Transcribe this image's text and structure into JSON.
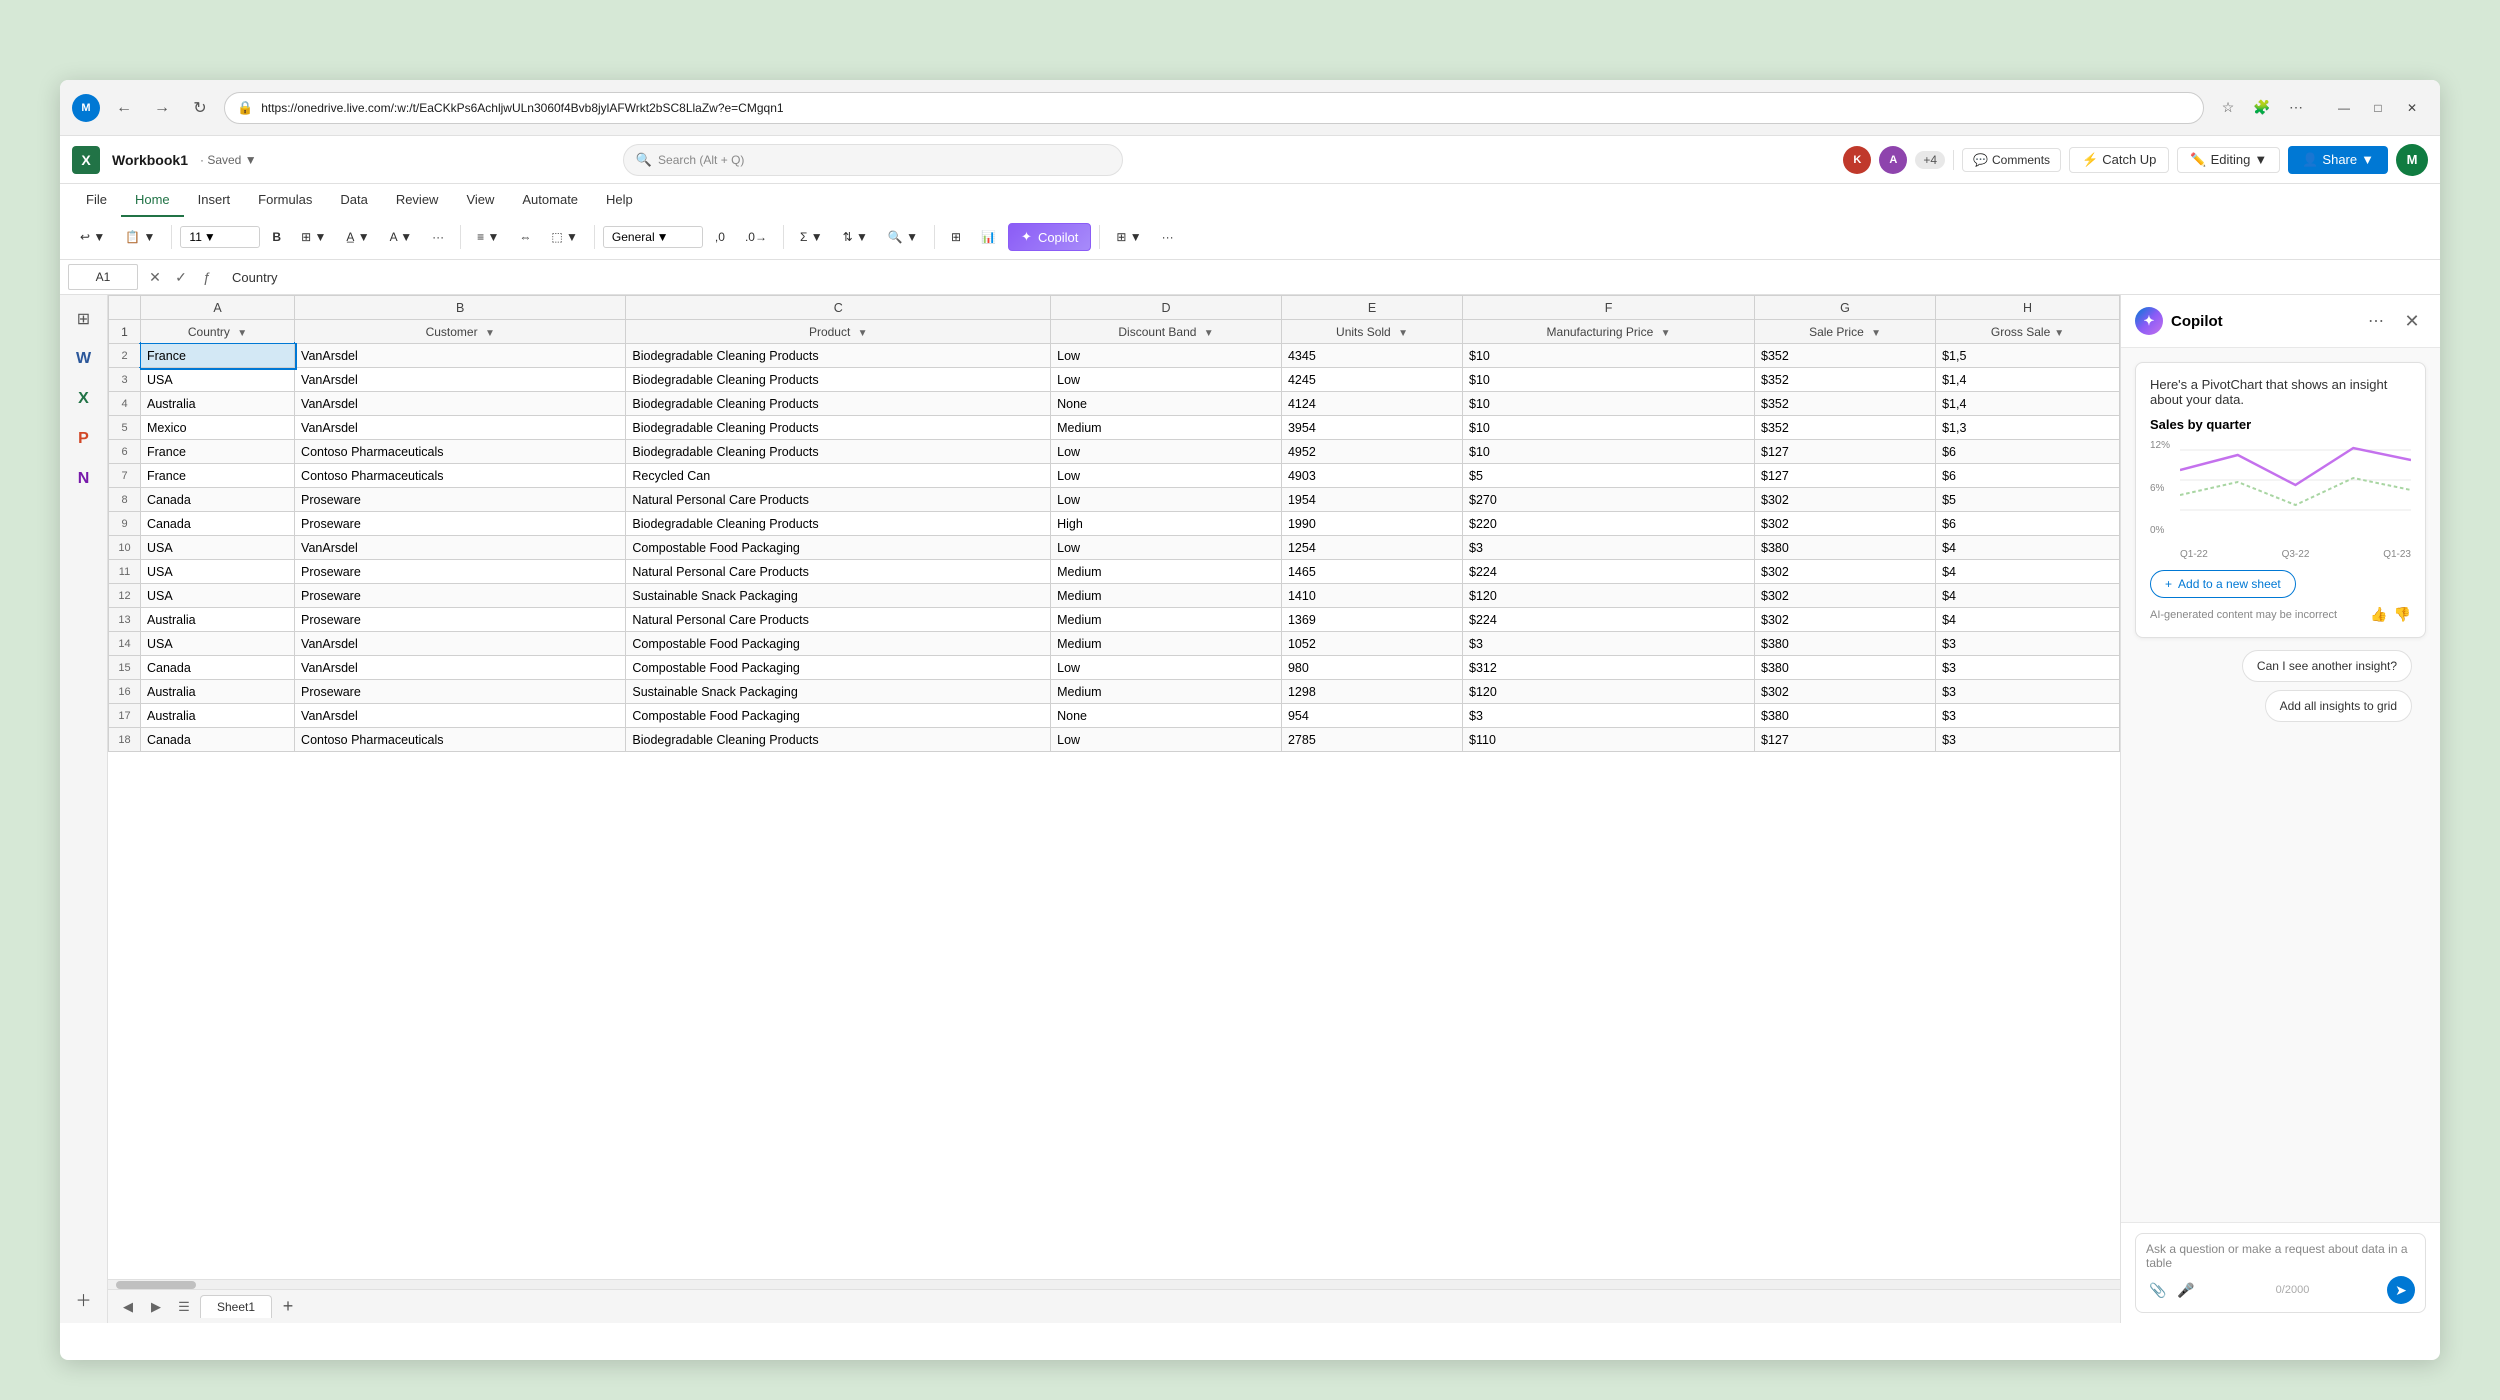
{
  "browser": {
    "url": "https://onedrive.live.com/:w:/t/EaCKkPs6AchljwULn3060f4Bvb8jylAFWrkt2bSC8LlaZw?e=CMgqn1",
    "search_placeholder": "Search (Alt + Q)"
  },
  "app": {
    "title": "Workbook1",
    "saved_text": "Saved",
    "icon_letter": "X"
  },
  "toolbar": {
    "comments_label": "Comments",
    "catchup_label": "Catch Up",
    "editing_label": "Editing",
    "share_label": "Share"
  },
  "ribbon": {
    "tabs": [
      "File",
      "Home",
      "Insert",
      "Formulas",
      "Data",
      "Review",
      "View",
      "Automate",
      "Help"
    ],
    "active_tab": "Home",
    "format_number": "General",
    "font_size": "11",
    "copilot_label": "Copilot"
  },
  "formula_bar": {
    "cell_ref": "A1",
    "value": "Country"
  },
  "sheet": {
    "columns": [
      "Country",
      "Customer",
      "Product",
      "Discount Band",
      "Units Sold",
      "Manufacturing Price",
      "Sale Price",
      "Gross Sale"
    ],
    "col_letters": [
      "A",
      "B",
      "C",
      "D",
      "E",
      "F",
      "G",
      "H"
    ],
    "rows": [
      [
        "France",
        "VanArsdel",
        "Biodegradable Cleaning Products",
        "Low",
        "4345",
        "$10",
        "$352",
        "$1,5"
      ],
      [
        "USA",
        "VanArsdel",
        "Biodegradable Cleaning Products",
        "Low",
        "4245",
        "$10",
        "$352",
        "$1,4"
      ],
      [
        "Australia",
        "VanArsdel",
        "Biodegradable Cleaning Products",
        "None",
        "4124",
        "$10",
        "$352",
        "$1,4"
      ],
      [
        "Mexico",
        "VanArsdel",
        "Biodegradable Cleaning Products",
        "Medium",
        "3954",
        "$10",
        "$352",
        "$1,3"
      ],
      [
        "France",
        "Contoso Pharmaceuticals",
        "Biodegradable Cleaning Products",
        "Low",
        "4952",
        "$10",
        "$127",
        "$6"
      ],
      [
        "France",
        "Contoso Pharmaceuticals",
        "Recycled Can",
        "Low",
        "4903",
        "$5",
        "$127",
        "$6"
      ],
      [
        "Canada",
        "Proseware",
        "Natural Personal Care Products",
        "Low",
        "1954",
        "$270",
        "$302",
        "$5"
      ],
      [
        "Canada",
        "Proseware",
        "Biodegradable Cleaning Products",
        "High",
        "1990",
        "$220",
        "$302",
        "$6"
      ],
      [
        "USA",
        "VanArsdel",
        "Compostable Food Packaging",
        "Low",
        "1254",
        "$3",
        "$380",
        "$4"
      ],
      [
        "USA",
        "Proseware",
        "Natural Personal Care Products",
        "Medium",
        "1465",
        "$224",
        "$302",
        "$4"
      ],
      [
        "USA",
        "Proseware",
        "Sustainable Snack Packaging",
        "Medium",
        "1410",
        "$120",
        "$302",
        "$4"
      ],
      [
        "Australia",
        "Proseware",
        "Natural Personal Care Products",
        "Medium",
        "1369",
        "$224",
        "$302",
        "$4"
      ],
      [
        "USA",
        "VanArsdel",
        "Compostable Food Packaging",
        "Medium",
        "1052",
        "$3",
        "$380",
        "$3"
      ],
      [
        "Canada",
        "VanArsdel",
        "Compostable Food Packaging",
        "Low",
        "980",
        "$312",
        "$380",
        "$3"
      ],
      [
        "Australia",
        "Proseware",
        "Sustainable Snack Packaging",
        "Medium",
        "1298",
        "$120",
        "$302",
        "$3"
      ],
      [
        "Australia",
        "VanArsdel",
        "Compostable Food Packaging",
        "None",
        "954",
        "$3",
        "$380",
        "$3"
      ],
      [
        "Canada",
        "Contoso Pharmaceuticals",
        "Biodegradable Cleaning Products",
        "Low",
        "2785",
        "$110",
        "$127",
        "$3"
      ]
    ],
    "tab_name": "Sheet1"
  },
  "copilot": {
    "title": "Copilot",
    "message": "Here's a PivotChart that shows an insight about your data.",
    "chart_title": "Sales by quarter",
    "chart": {
      "y_labels": [
        "12%",
        "6%",
        "0%"
      ],
      "x_labels": [
        "Q1-22",
        "Q3-22",
        "Q1-23"
      ],
      "line1_points": "0,28 60,18 120,32 180,12",
      "line2_points": "0,60 60,45 120,70 180,50"
    },
    "add_to_sheet_label": "Add to a new sheet",
    "ai_disclaimer": "AI-generated content may be incorrect",
    "another_insight_label": "Can I see another insight?",
    "add_all_label": "Add all insights to grid",
    "input_placeholder": "Ask a question or make a request about data in a table",
    "char_count": "0/2000"
  }
}
